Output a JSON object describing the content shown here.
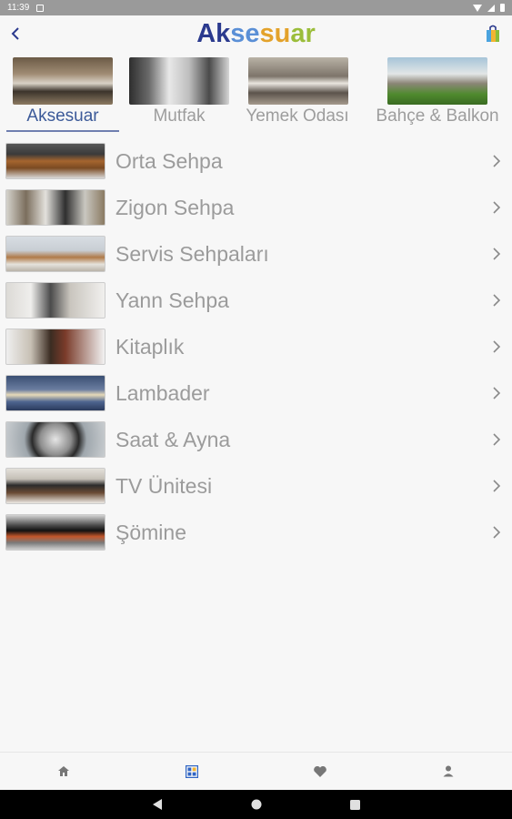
{
  "status_bar": {
    "time": "11:39"
  },
  "header": {
    "logo_parts": [
      "Ak",
      "se",
      "su",
      "ar"
    ],
    "back_icon": "chevron-left-icon",
    "bag_icon": "shopping-bag-icon"
  },
  "tabs": [
    {
      "label": "Aksesuar",
      "active": true
    },
    {
      "label": "Mutfak",
      "active": false
    },
    {
      "label": "Yemek Odası",
      "active": false
    },
    {
      "label": "Bahçe & Balkon",
      "active": false
    }
  ],
  "items": [
    {
      "label": "Orta Sehpa"
    },
    {
      "label": "Zigon Sehpa"
    },
    {
      "label": "Servis Sehpaları"
    },
    {
      "label": "Yann Sehpa"
    },
    {
      "label": "Kitaplık"
    },
    {
      "label": "Lambader"
    },
    {
      "label": "Saat & Ayna"
    },
    {
      "label": "TV Ünitesi"
    },
    {
      "label": "Şömine"
    }
  ],
  "bottom_nav": {
    "items": [
      "home-icon",
      "grid-icon",
      "heart-icon",
      "person-icon"
    ],
    "active_index": 1
  },
  "colors": {
    "accent": "#3c5a99",
    "text_muted": "#9b9b9b",
    "logo_blue": "#2b3a8e"
  }
}
